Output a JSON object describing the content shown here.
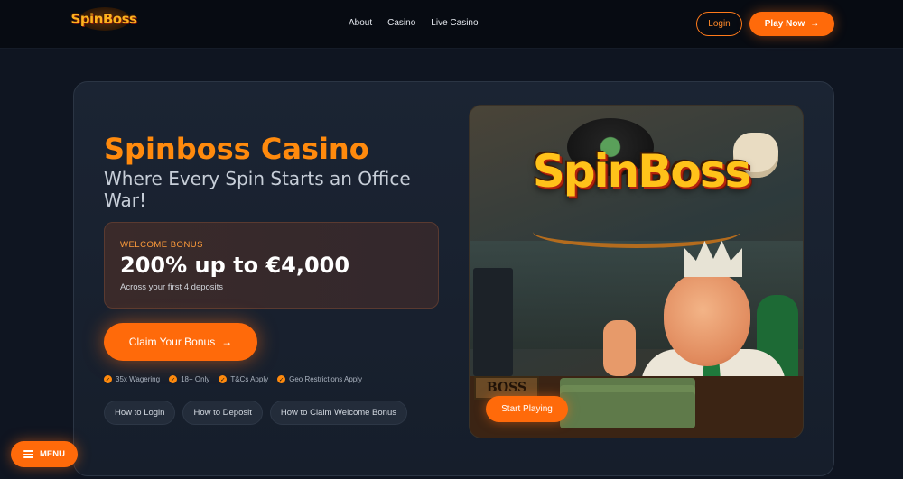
{
  "header": {
    "logo_text": "SpinBoss",
    "nav": [
      "About",
      "Casino",
      "Live Casino"
    ],
    "login_label": "Login",
    "play_label": "Play Now",
    "play_icon": "arrow-right-icon"
  },
  "hero": {
    "title": "Spinboss Casino",
    "subtitle": "Where Every Spin Starts an Office War!",
    "bonus": {
      "label": "WELCOME BONUS",
      "amount": "200% up to €4,000",
      "note": "Across your first 4 deposits"
    },
    "claim_label": "Claim Your Bonus",
    "claim_icon": "arrow-right-icon",
    "terms": [
      "35x Wagering",
      "18+ Only",
      "T&Cs Apply",
      "Geo Restrictions Apply"
    ],
    "howto": [
      "How to Login",
      "How to Deposit",
      "How to Claim Welcome Bonus"
    ]
  },
  "image": {
    "logo_text": "SpinBoss",
    "sign_text": "BOSS",
    "start_label": "Start Playing"
  },
  "menu": {
    "label": "MENU",
    "icon": "hamburger-icon"
  },
  "colors": {
    "accent": "#ff6a0a",
    "title": "#ff8a0d",
    "background": "#0f1521",
    "card": "#1b2433"
  }
}
